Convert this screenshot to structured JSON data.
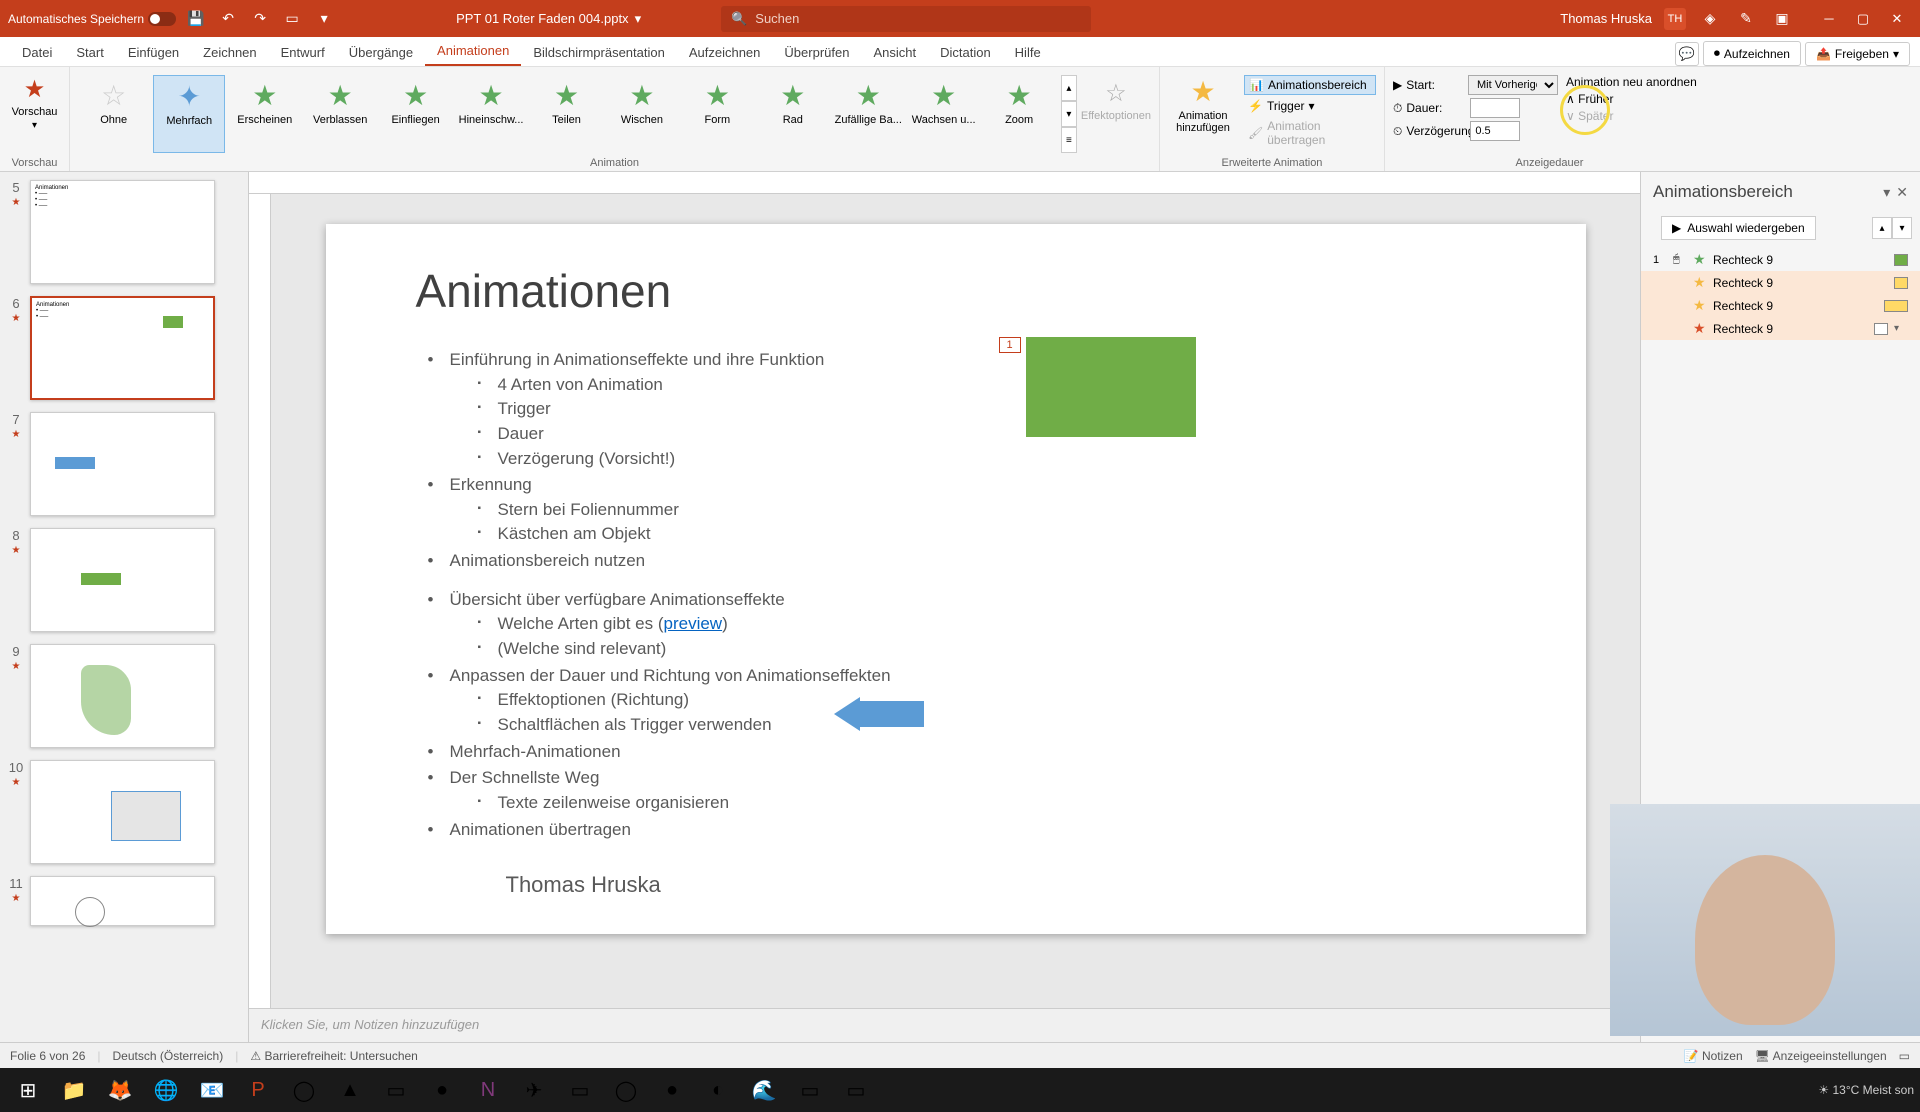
{
  "titleBar": {
    "autosave": "Automatisches Speichern",
    "filename": "PPT 01 Roter Faden 004.pptx",
    "searchPlaceholder": "Suchen",
    "userName": "Thomas Hruska",
    "userInitials": "TH"
  },
  "ribbonTabs": {
    "items": [
      "Datei",
      "Start",
      "Einfügen",
      "Zeichnen",
      "Entwurf",
      "Übergänge",
      "Animationen",
      "Bildschirmpräsentation",
      "Aufzeichnen",
      "Überprüfen",
      "Ansicht",
      "Dictation",
      "Hilfe"
    ],
    "activeIndex": 6,
    "record": "Aufzeichnen",
    "share": "Freigeben"
  },
  "ribbon": {
    "preview": "Vorschau",
    "previewGroup": "Vorschau",
    "animItems": [
      "Ohne",
      "Mehrfach",
      "Erscheinen",
      "Verblassen",
      "Einfliegen",
      "Hineinschw...",
      "Teilen",
      "Wischen",
      "Form",
      "Rad",
      "Zufällige Ba...",
      "Wachsen u...",
      "Zoom"
    ],
    "animGroup": "Animation",
    "effectOptions": "Effektoptionen",
    "addAnim": "Animation hinzufügen",
    "animPane": "Animationsbereich",
    "trigger": "Trigger",
    "animPainter": "Animation übertragen",
    "advGroup": "Erweiterte Animation",
    "start": "Start:",
    "startValue": "Mit Vorheriger",
    "duration": "Dauer:",
    "delay": "Verzögerung:",
    "delayValue": "0.5",
    "reorderTitle": "Animation neu anordnen",
    "earlier": "Früher",
    "later": "Später",
    "timingGroup": "Anzeigedauer"
  },
  "thumbs": {
    "numbers": [
      "5",
      "6",
      "7",
      "8",
      "9",
      "10",
      "11"
    ],
    "selectedIndex": 1
  },
  "slide": {
    "title": "Animationen",
    "b1": "Einführung in Animationseffekte und ihre Funktion",
    "b1_1": "4 Arten von Animation",
    "b1_2": "Trigger",
    "b1_3": "Dauer",
    "b1_4": "Verzögerung (Vorsicht!)",
    "b2": "Erkennung",
    "b2_1": "Stern bei Foliennummer",
    "b2_2": "Kästchen am Objekt",
    "b3": "Animationsbereich nutzen",
    "b4": "Übersicht über verfügbare Animationseffekte",
    "b4_1a": "Welche Arten gibt es (",
    "b4_1link": "preview",
    "b4_1b": ")",
    "b4_2": "(Welche sind relevant)",
    "b5": "Anpassen der Dauer und Richtung von Animationseffekten",
    "b5_1": "Effektoptionen (Richtung)",
    "b5_2": "Schaltflächen als Trigger verwenden",
    "b6": "Mehrfach-Animationen",
    "b7": "Der Schnellste Weg",
    "b7_1": "Texte zeilenweise organisieren",
    "b8": "Animationen übertragen",
    "author": "Thomas Hruska",
    "animTag": "1"
  },
  "animPane": {
    "title": "Animationsbereich",
    "play": "Auswahl wiedergeben",
    "entries": [
      {
        "num": "1",
        "name": "Rechteck 9"
      },
      {
        "num": "",
        "name": "Rechteck 9"
      },
      {
        "num": "",
        "name": "Rechteck 9"
      },
      {
        "num": "",
        "name": "Rechteck 9"
      }
    ]
  },
  "notes": "Klicken Sie, um Notizen hinzuzufügen",
  "statusBar": {
    "slideInfo": "Folie 6 von 26",
    "lang": "Deutsch (Österreich)",
    "access": "Barrierefreiheit: Untersuchen",
    "notes": "Notizen",
    "displaySettings": "Anzeigeeinstellungen"
  },
  "taskBar": {
    "weather": "13°C  Meist son"
  }
}
